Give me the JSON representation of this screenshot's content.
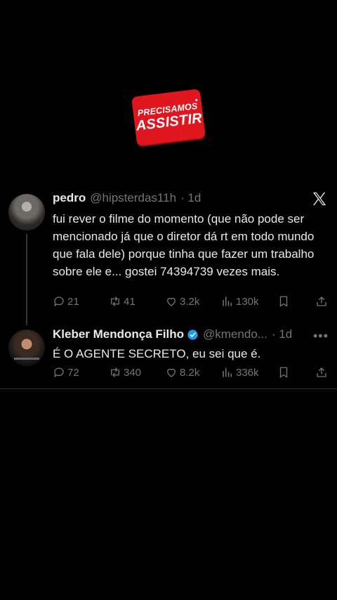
{
  "brand": {
    "line1": "PRECISAMOS",
    "line2": "ASSISTIR",
    "color": "#e0161f"
  },
  "tweets": [
    {
      "name": "pedro",
      "handle": "@hipsterdas11h",
      "time": "· 1d",
      "text": "fui rever o filme do momento (que não pode ser mencionado já que o diretor dá rt em todo mundo que fala dele) porque tinha que fazer um trabalho sobre ele e... gostei 74394739 vezes mais.",
      "replies": "21",
      "retweets": "41",
      "likes": "3.2k",
      "views": "130k"
    },
    {
      "name": "Kleber Mendonça Filho",
      "handle": "@kmendo...",
      "time": "· 1d",
      "text": "É O AGENTE SECRETO, eu sei que é.",
      "replies": "72",
      "retweets": "340",
      "likes": "8.2k",
      "views": "336k",
      "verified": true
    }
  ],
  "icons": [
    "x-logo-icon",
    "more-icon",
    "reply-icon",
    "retweet-icon",
    "like-icon",
    "views-icon",
    "bookmark-icon",
    "share-icon",
    "verified-icon"
  ],
  "colors": {
    "background": "#000000",
    "text": "#e7e9ea",
    "muted": "#71767b",
    "verified": "#1d9bf0"
  }
}
